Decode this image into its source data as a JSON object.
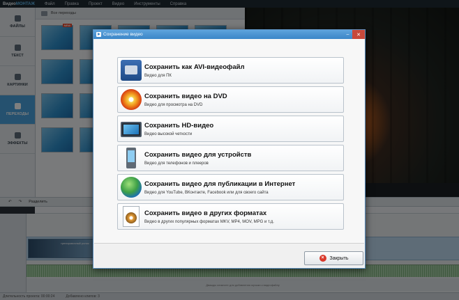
{
  "app": {
    "logo_main": "Видео",
    "logo_accent": "МОНТАЖ",
    "menu": [
      "Файл",
      "Правка",
      "Проект",
      "Видео",
      "Инструменты",
      "Справка"
    ]
  },
  "sidebar": {
    "items": [
      {
        "label": "ФАЙЛЫ",
        "icon": "files-icon"
      },
      {
        "label": "ТЕКСТ",
        "icon": "text-icon"
      },
      {
        "label": "КАРТИНКИ",
        "icon": "pictures-icon"
      },
      {
        "label": "ПЕРЕХОДЫ",
        "icon": "transitions-icon"
      },
      {
        "label": "ЭФФЕКТЫ",
        "icon": "effects-icon"
      }
    ]
  },
  "gallery": {
    "folder_label": "Все переходы",
    "new_badge": "NEW"
  },
  "timeline": {
    "split_label": "Разделить",
    "clip_label": "тренировочный ролик",
    "music_placeholder": "Дважды кликните для добавления музыки к видеофайлу"
  },
  "status": {
    "duration": "Длительность проекта: 00:00:24",
    "active_count": "Добавлено клипов: 3"
  },
  "dialog": {
    "title": "Сохранение видео",
    "options": [
      {
        "title": "Сохранить как AVI-видеофайл",
        "desc": "Видео для ПК",
        "icon": "avi-film-icon"
      },
      {
        "title": "Сохранить видео на DVD",
        "desc": "Видео для просмотра на DVD",
        "icon": "dvd-disc-icon"
      },
      {
        "title": "Сохранить HD-видео",
        "desc": "Видео высокой четкости",
        "icon": "hd-monitor-icon"
      },
      {
        "title": "Сохранить видео для устройств",
        "desc": "Видео для телефонов и плееров",
        "icon": "phone-icon"
      },
      {
        "title": "Сохранить видео для публикации в Интернет",
        "desc": "Видео для YouTube, ВКонтакте, Facebook или для своего сайта",
        "icon": "globe-icon"
      },
      {
        "title": "Сохранить видео в других форматах",
        "desc": "Видео в других популярных форматах MKV, MP4, MOV, MPG и т.д.",
        "icon": "video-file-icon"
      }
    ],
    "close_label": "Закрыть"
  }
}
